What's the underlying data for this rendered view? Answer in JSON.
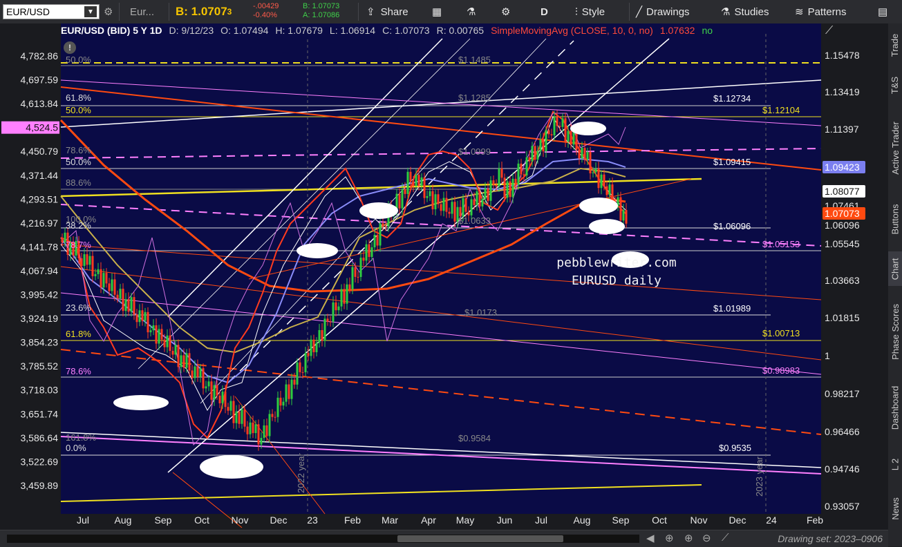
{
  "toolbar": {
    "symbol": "EUR/USD",
    "quote_tab": "Eur...",
    "bid_label": "B: 1.0707",
    "bid_sub": "3",
    "change": "-.00429",
    "change_pct": "-0.40%",
    "bid_small": "B: 1.07073",
    "ask_small": "A: 1.07086",
    "share": "Share",
    "period": "D",
    "style": "Style",
    "drawings": "Drawings",
    "studies": "Studies",
    "patterns": "Patterns"
  },
  "header": {
    "instrument": "EUR/USD (BID) 5 Y 1D",
    "date": "D: 9/12/23",
    "open": "O: 1.07494",
    "high": "H: 1.07679",
    "low": "L: 1.06914",
    "close": "C: 1.07073",
    "range": "R: 0.00765",
    "study": "SimpleMovingAvg (CLOSE, 10, 0, no)",
    "study_value": "1.07632",
    "study_flag": "no"
  },
  "sidebar": [
    "Trade",
    "T&S",
    "Active Trader",
    "Buttons",
    "Chart",
    "Phase Scores",
    "Dashboard",
    "L 2",
    "News"
  ],
  "left_axis": [
    "4,782.86",
    "4,697.59",
    "4,613.84",
    "4,524.5",
    "4,450.79",
    "4,371.44",
    "4,293.51",
    "4,216.97",
    "4,141.78",
    "4,067.94",
    "3,995.42",
    "3,924.19",
    "3,854.23",
    "3,785.52",
    "3,718.03",
    "3,651.74",
    "3,586.64",
    "3,522.69",
    "3,459.89"
  ],
  "right_axis": [
    "1.15478",
    "1.13419",
    "1.11397",
    "1.09423",
    "1.08077",
    "1.07461",
    "1.07073",
    "1.06096",
    "1.05545",
    "1.03663",
    "1.01815",
    "1",
    "0.98217",
    "0.96466",
    "0.94746",
    "0.93057"
  ],
  "months": [
    "Jul",
    "Aug",
    "Sep",
    "Oct",
    "Nov",
    "Dec",
    "23",
    "Feb",
    "Mar",
    "Apr",
    "May",
    "Jun",
    "Jul",
    "Aug",
    "Sep",
    "Oct",
    "Nov",
    "Dec",
    "24",
    "Feb"
  ],
  "fib_labels": [
    "50.0%",
    "61.8%",
    "50.0%",
    "78.6%",
    "50.0%",
    "88.6%",
    "100.0%",
    "38.2%",
    "78.7%",
    "23.6%",
    "61.8%",
    "78.6%",
    "161.8%",
    "0.0%"
  ],
  "price_tags": [
    "$1.1485",
    "$1.1285",
    "$1.0999",
    "$1.0633",
    "$1.0173",
    "$0.9584",
    "$1.12734",
    "$1.12104",
    "$1.09415",
    "$1.06096",
    "$1.05153",
    "$1.01989",
    "$1.00713",
    "$0.98983",
    "$0.9535"
  ],
  "annotation": {
    "line1": "pebblewriter.com",
    "line2": "EURUSD daily"
  },
  "year_labels": [
    "2022 year",
    "2023 year"
  ],
  "drawing_set": "Drawing set: 2023–0906",
  "colors": {
    "bg": "#0a0b46",
    "price_up": "#2ecc40",
    "price_down": "#ff3b1f",
    "ma_red": "#ff4a10",
    "fib_yellow": "#f0e020",
    "magenta": "#ff80ff",
    "quote_green": "#3fd14a",
    "quote_red": "#ff3b30",
    "bid_yellow": "#f5c400"
  }
}
